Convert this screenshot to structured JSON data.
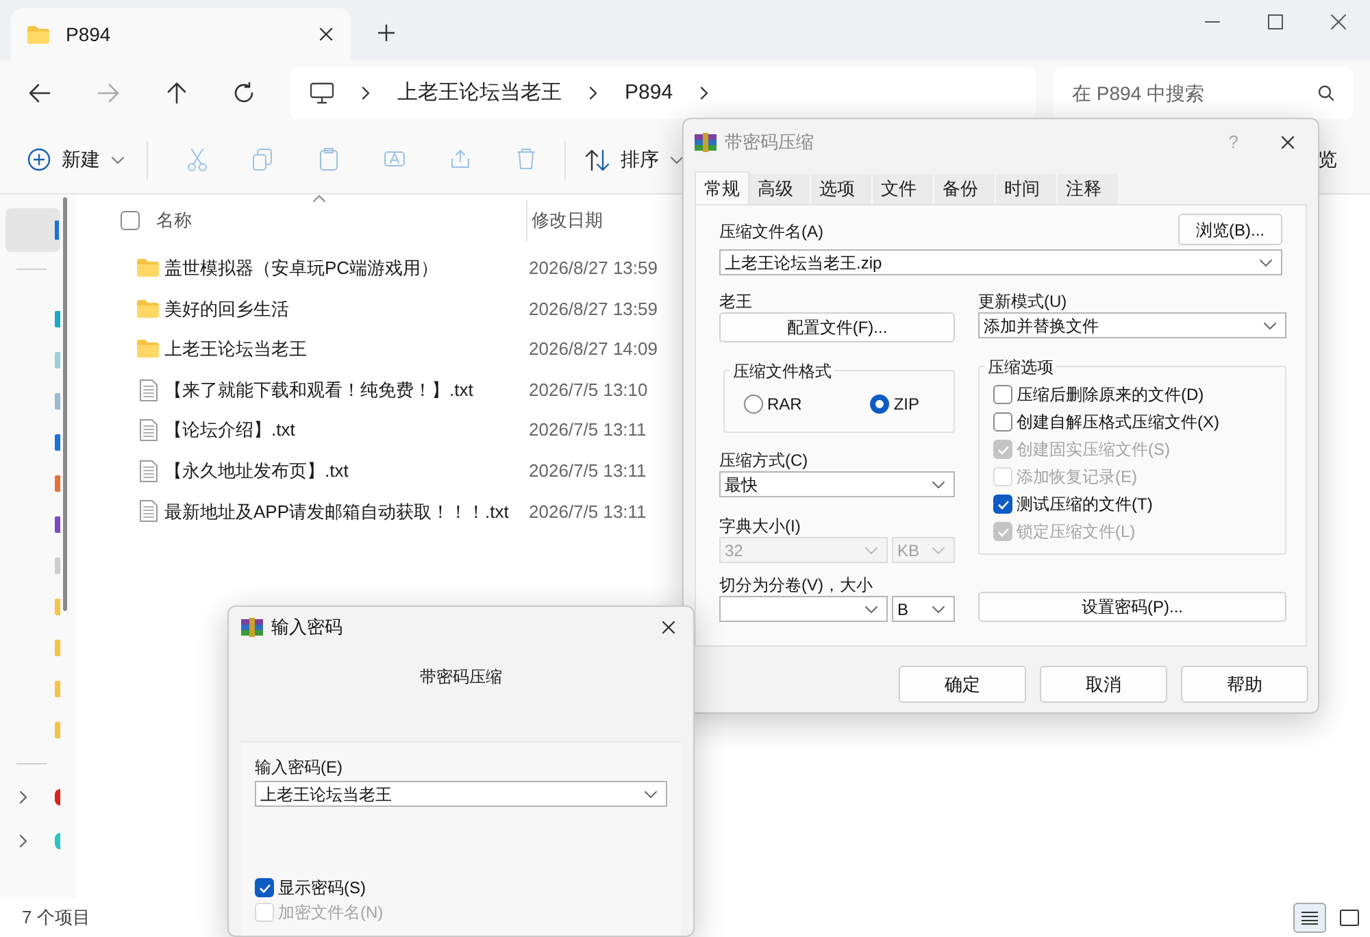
{
  "explorer": {
    "tab": {
      "title": "P894"
    },
    "breadcrumb": [
      "上老王论坛当老王",
      "P894"
    ],
    "search": {
      "placeholder": "在 P894 中搜索"
    },
    "toolbar": {
      "new": "新建",
      "sort": "排序",
      "partial": "览"
    },
    "select_all_checked": false,
    "columns": [
      "名称",
      "修改日期"
    ],
    "files": [
      {
        "kind": "folder",
        "name": "盖世模拟器（安卓玩PC端游戏用）",
        "date": "2026/8/27 13:59"
      },
      {
        "kind": "folder",
        "name": "美好的回乡生活",
        "date": "2026/8/27 13:59"
      },
      {
        "kind": "folder",
        "name": "上老王论坛当老王",
        "date": "2026/8/27 14:09"
      },
      {
        "kind": "text",
        "name": "【来了就能下载和观看！纯免费！】.txt",
        "date": "2026/7/5 13:10"
      },
      {
        "kind": "text",
        "name": "【论坛介绍】.txt",
        "date": "2026/7/5 13:11"
      },
      {
        "kind": "text",
        "name": "【永久地址发布页】.txt",
        "date": "2026/7/5 13:11"
      },
      {
        "kind": "text",
        "name": "最新地址及APP请发邮箱自动获取！！！.txt",
        "date": "2026/7/5 13:11"
      }
    ],
    "status_bar": "7 个项目"
  },
  "compress_dialog": {
    "title": "带密码压缩",
    "help": "?",
    "tabs": [
      {
        "label": "常规",
        "selected": true
      },
      {
        "label": "高级",
        "selected": false
      },
      {
        "label": "选项",
        "selected": false
      },
      {
        "label": "文件",
        "selected": false
      },
      {
        "label": "备份",
        "selected": false
      },
      {
        "label": "时间",
        "selected": false
      },
      {
        "label": "注释",
        "selected": false
      }
    ],
    "archive_name_label": "压缩文件名(A)",
    "browse_button": "浏览(B)...",
    "archive_name": "上老王论坛当老王.zip",
    "profile_label": "老王",
    "profile_button": "配置文件(F)...",
    "update_mode_label": "更新模式(U)",
    "update_mode": "添加并替换文件",
    "format_group": {
      "label": "压缩文件格式",
      "options": [
        {
          "label": "RAR",
          "selected": false
        },
        {
          "label": "ZIP",
          "selected": true
        }
      ]
    },
    "options_group": {
      "label": "压缩选项",
      "items": [
        {
          "label": "压缩后删除原来的文件(D)",
          "checked": false,
          "disabled": false
        },
        {
          "label": "创建自解压格式压缩文件(X)",
          "checked": false,
          "disabled": false
        },
        {
          "label": "创建固实压缩文件(S)",
          "checked": true,
          "disabled": true
        },
        {
          "label": "添加恢复记录(E)",
          "checked": false,
          "disabled": true
        },
        {
          "label": "测试压缩的文件(T)",
          "checked": true,
          "disabled": false
        },
        {
          "label": "锁定压缩文件(L)",
          "checked": true,
          "disabled": true
        }
      ]
    },
    "method_label": "压缩方式(C)",
    "method": "最快",
    "dictionary_label": "字典大小(I)",
    "dictionary": {
      "value": "32",
      "unit": "KB",
      "disabled": true
    },
    "split_label": "切分为分卷(V)，大小",
    "split_unit": "B",
    "set_password_button": "设置密码(P)...",
    "buttons": [
      "确定",
      "取消",
      "帮助"
    ]
  },
  "password_dialog": {
    "title": "输入密码",
    "heading": "带密码压缩",
    "password_label": "输入密码(E)",
    "password": "上老王论坛当老王",
    "checkboxes": [
      {
        "label": "显示密码(S)",
        "checked": true,
        "disabled": false
      },
      {
        "label": "加密文件名(N)",
        "checked": false,
        "disabled": true
      }
    ]
  }
}
